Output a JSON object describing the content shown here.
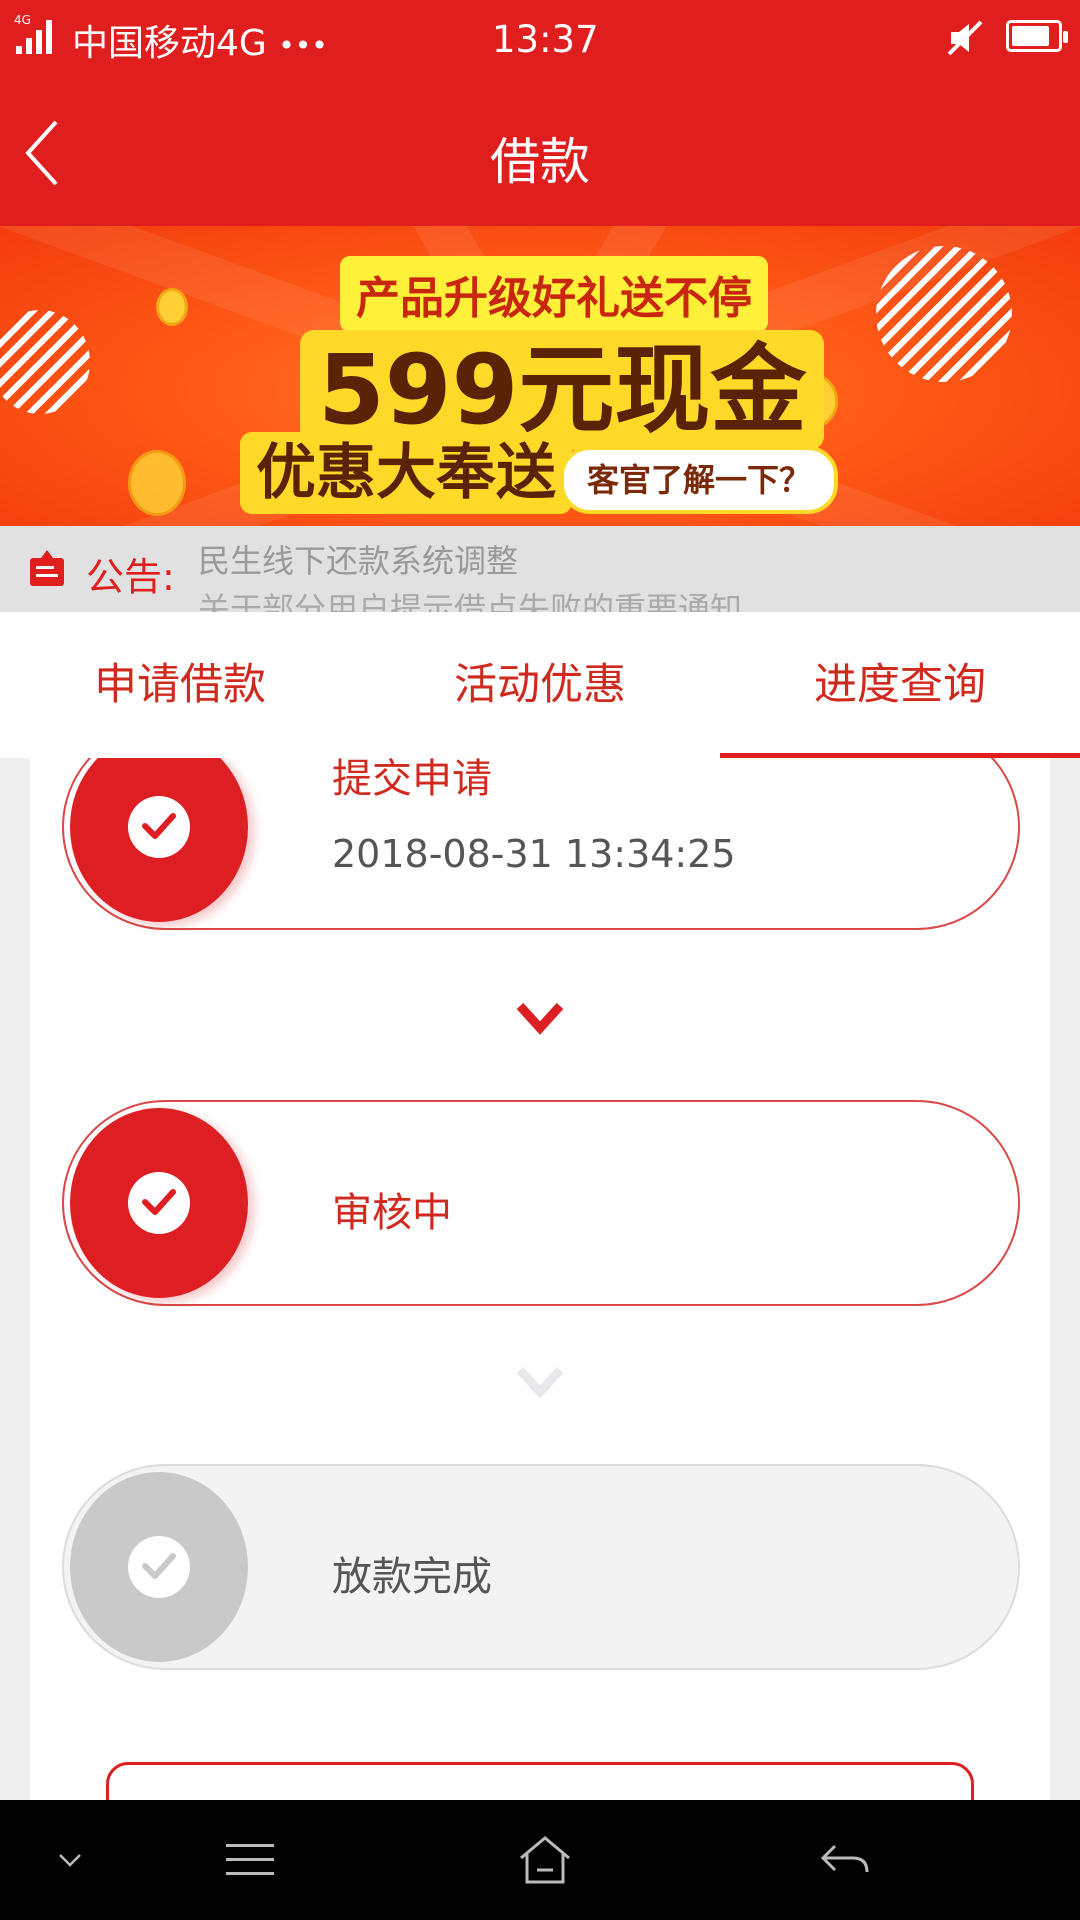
{
  "status_bar": {
    "signal_badge": "4G",
    "carrier": "中国移动4G",
    "more": "•••",
    "time": "13:37",
    "battery_level_percent": 85
  },
  "header": {
    "title": "借款",
    "back_icon": "chevron-left-icon"
  },
  "banner": {
    "line1": "产品升级好礼送不停",
    "line2": "599元现金",
    "line3": "优惠大奉送",
    "pill": "客官了解一下？",
    "coin_symbol": "¥"
  },
  "notice": {
    "label": "公告:",
    "messages": [
      "民生线下还款系统调整",
      "关于部分用户提示借点失败的重要通知"
    ]
  },
  "tabs": [
    {
      "label": "申请借款",
      "active": false
    },
    {
      "label": "活动优惠",
      "active": false
    },
    {
      "label": "进度查询",
      "active": true
    }
  ],
  "steps": [
    {
      "name": "提交申请",
      "time": "2018-08-31 13:34:25",
      "done": true
    },
    {
      "name": "审核中",
      "time": "",
      "done": true
    },
    {
      "name": "放款完成",
      "time": "",
      "done": false
    }
  ],
  "colors": {
    "brand_red": "#e01e1e",
    "pending_gray": "#c9c9c9"
  }
}
